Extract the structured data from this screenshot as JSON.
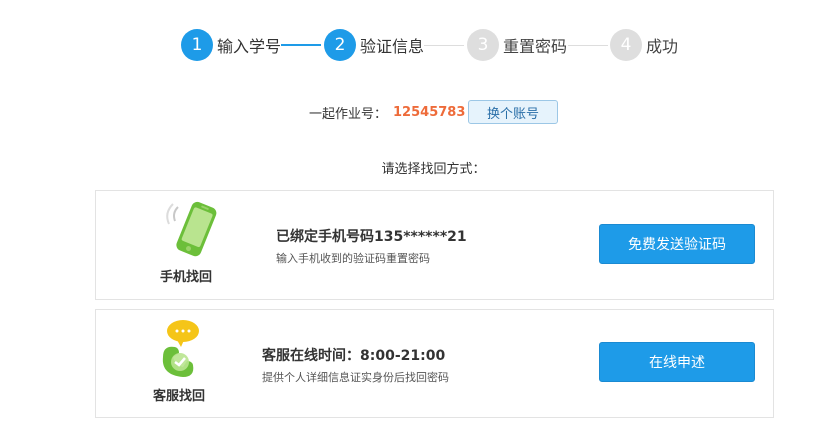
{
  "stepper": {
    "steps": [
      {
        "number": "1",
        "label": "输入学号",
        "state": "active"
      },
      {
        "number": "2",
        "label": "验证信息",
        "state": "active"
      },
      {
        "number": "3",
        "label": "重置密码",
        "state": "inactive"
      },
      {
        "number": "4",
        "label": "成功",
        "state": "inactive"
      }
    ]
  },
  "account": {
    "label": "一起作业号：",
    "id": "12545783",
    "switch_label": "换个账号"
  },
  "choose_tip": "请选择找回方式：",
  "methods": [
    {
      "icon": "phone-icon",
      "caption": "手机找回",
      "title": "已绑定手机号码135******21",
      "desc": "输入手机收到的验证码重置密码",
      "button": "免费发送验证码"
    },
    {
      "icon": "customer-service-icon",
      "caption": "客服找回",
      "title": "客服在线时间：8:00-21:00",
      "desc": "提供个人详细信息证实身份后找回密码",
      "button": "在线申述"
    }
  ],
  "colors": {
    "primary": "#1e9be8",
    "inactive_step": "#dedede",
    "account_id": "#ee6b3a",
    "phone_green": "#7ac943",
    "bubble_yellow": "#f5c518"
  }
}
